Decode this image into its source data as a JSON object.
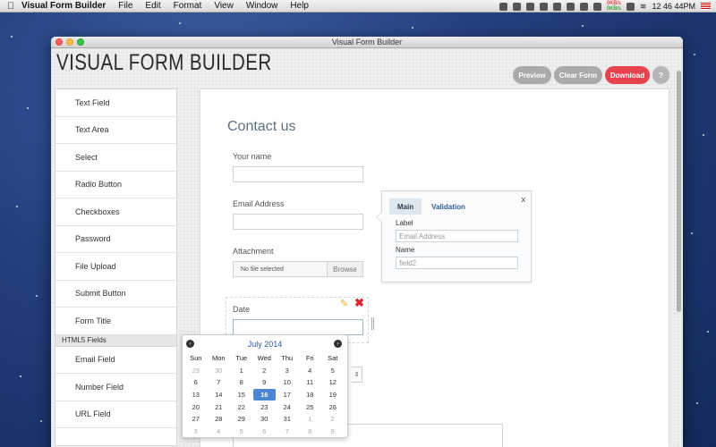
{
  "menubar": {
    "app_name": "Visual Form Builder",
    "menus": [
      "File",
      "Edit",
      "Format",
      "View",
      "Window",
      "Help"
    ],
    "net_up": "0KB/s",
    "net_down": "0KB/s",
    "clock": "12 46 44PM"
  },
  "window": {
    "title": "Visual Form Builder"
  },
  "app": {
    "title": "VISUAL FORM BUILDER",
    "buttons": {
      "preview": "Preview",
      "clear": "Clear Form",
      "download": "Download",
      "help": "?"
    }
  },
  "sidebar": {
    "items": [
      "Text Field",
      "Text Area",
      "Select",
      "Radio Button",
      "Checkboxes",
      "Password",
      "File Upload",
      "Submit Button",
      "Form Title"
    ],
    "section_header": "HTML5 Fields",
    "html5_items": [
      "Email Field",
      "Number Field",
      "URL Field"
    ]
  },
  "form": {
    "title": "Contact us",
    "fields": {
      "name_label": "Your name",
      "email_label": "Email Address",
      "attachment_label": "Attachment",
      "file_placeholder": "No file selected",
      "browse_label": "Browse",
      "date_label": "Date"
    }
  },
  "properties": {
    "close": "x",
    "tab_main": "Main",
    "tab_validation": "Validation",
    "label_caption": "Label",
    "label_value": "Email Address",
    "name_caption": "Name",
    "name_value": "field2"
  },
  "calendar": {
    "month_title": "July 2014",
    "prev": "‹",
    "next": "›",
    "weekdays": [
      "Sun",
      "Mon",
      "Tue",
      "Wed",
      "Thu",
      "Fri",
      "Sat"
    ],
    "selected_day": "16",
    "weeks": [
      [
        "29",
        "30",
        "1",
        "2",
        "3",
        "4",
        "5"
      ],
      [
        "6",
        "7",
        "8",
        "9",
        "10",
        "11",
        "12"
      ],
      [
        "13",
        "14",
        "15",
        "16",
        "17",
        "18",
        "19"
      ],
      [
        "20",
        "21",
        "22",
        "23",
        "24",
        "25",
        "26"
      ],
      [
        "27",
        "28",
        "29",
        "30",
        "31",
        "1",
        "2"
      ],
      [
        "3",
        "4",
        "5",
        "6",
        "7",
        "8",
        "9"
      ]
    ],
    "muted": [
      [
        true,
        true,
        false,
        false,
        false,
        false,
        false
      ],
      [
        false,
        false,
        false,
        false,
        false,
        false,
        false
      ],
      [
        false,
        false,
        false,
        false,
        false,
        false,
        false
      ],
      [
        false,
        false,
        false,
        false,
        false,
        false,
        false
      ],
      [
        false,
        false,
        false,
        false,
        false,
        true,
        true
      ],
      [
        true,
        true,
        true,
        true,
        true,
        true,
        true
      ]
    ]
  }
}
